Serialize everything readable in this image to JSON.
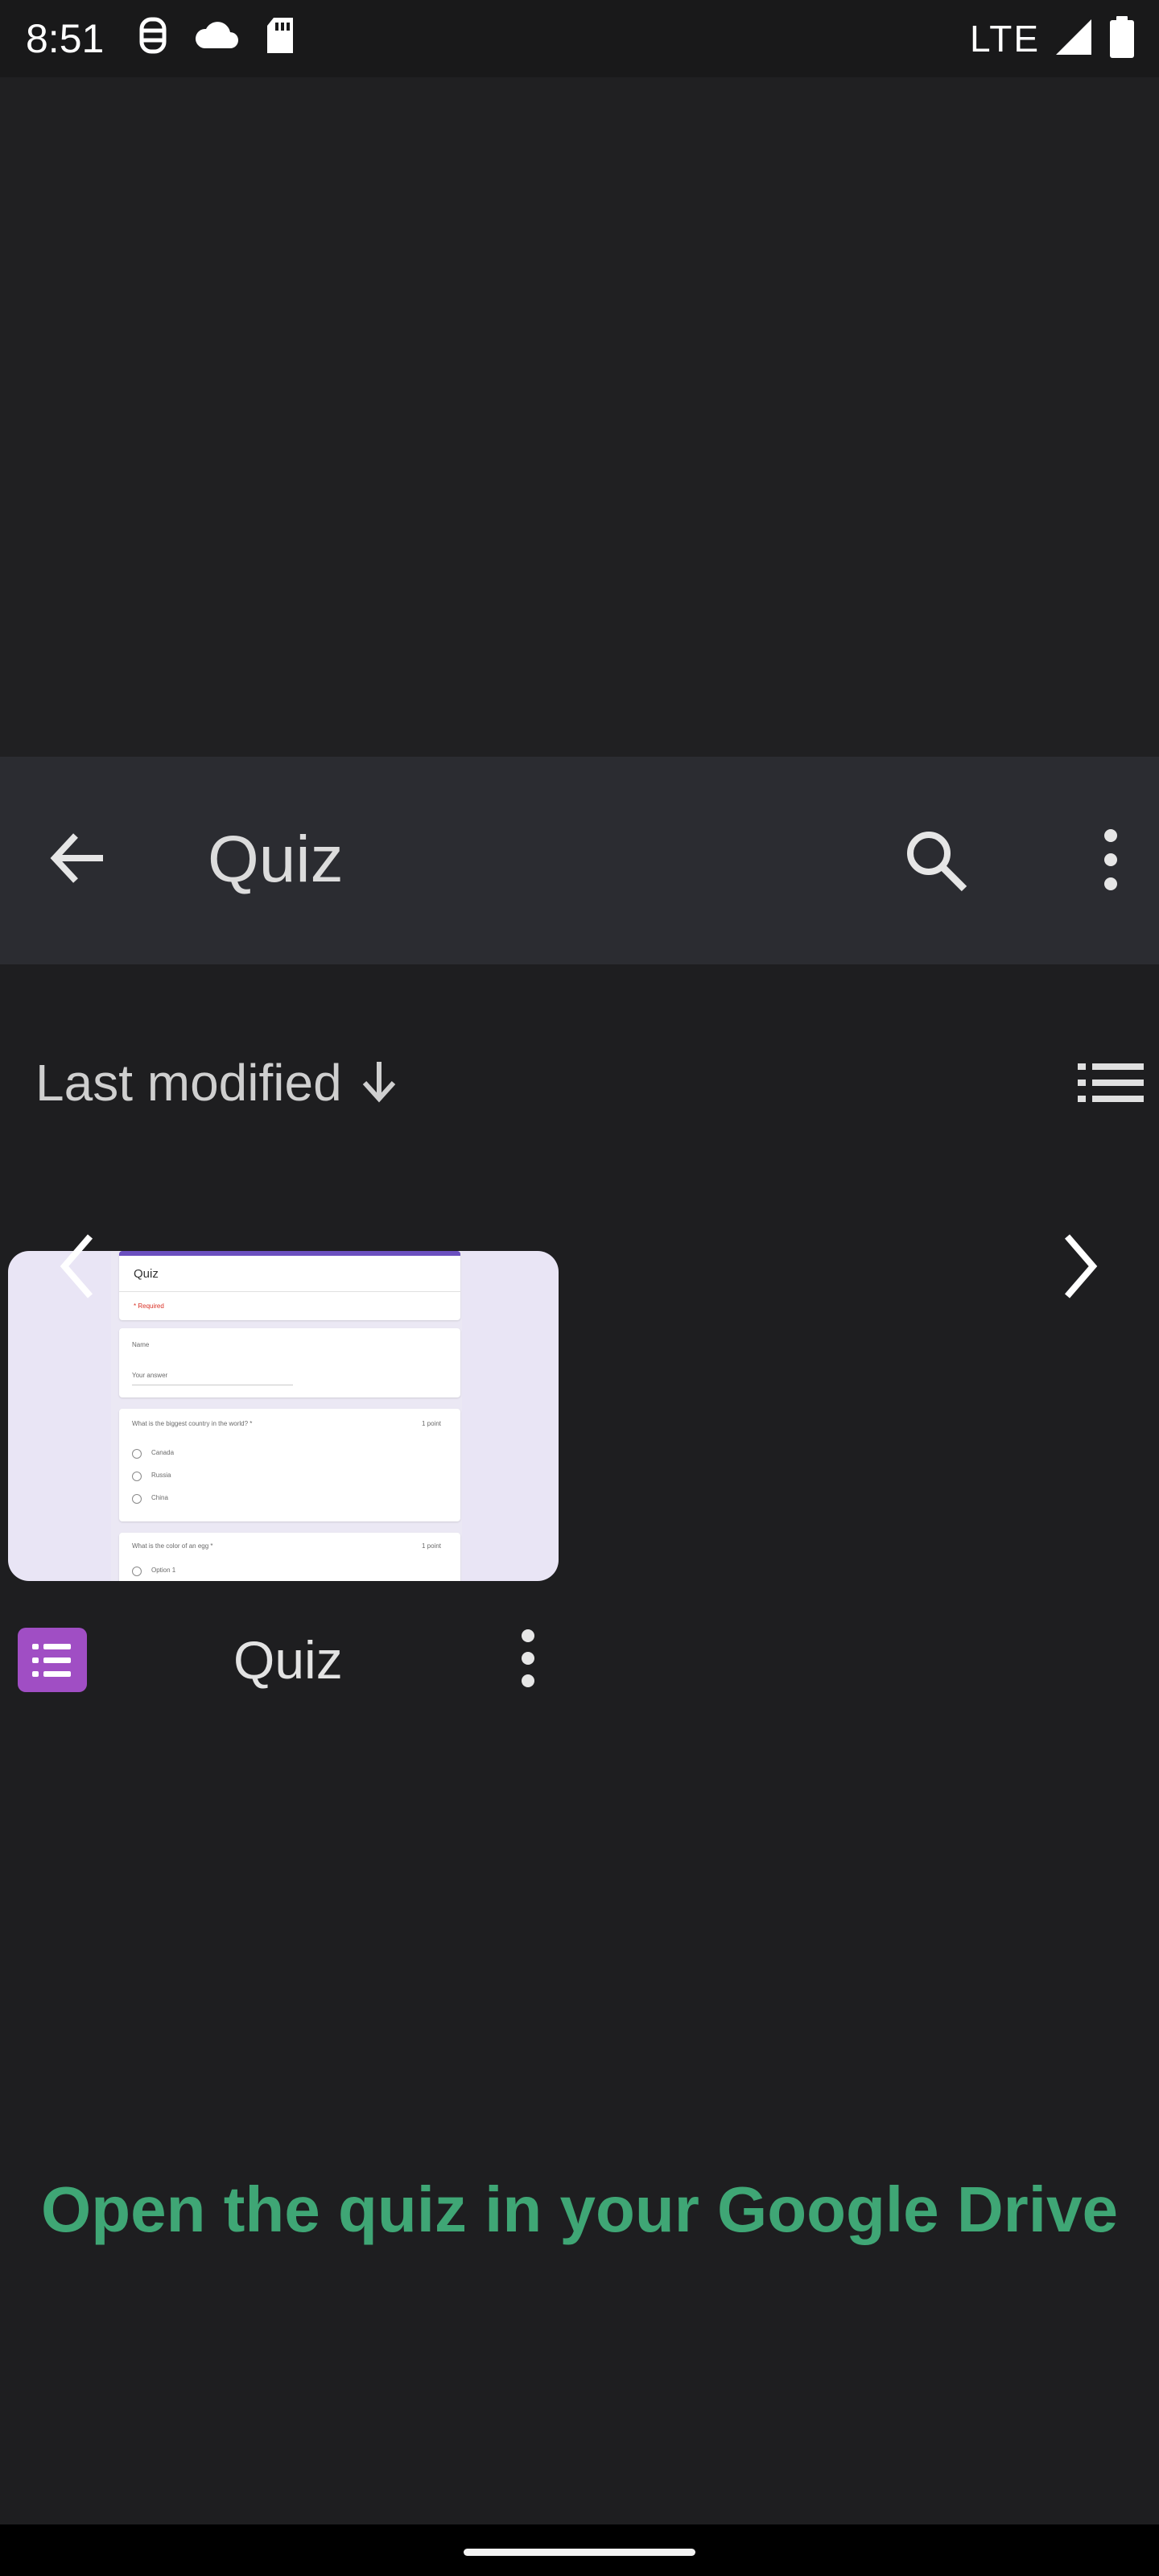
{
  "status_bar": {
    "time": "8:51",
    "network": "LTE",
    "left_icons": [
      "debug-icon",
      "cloud-icon",
      "sd-card-icon"
    ],
    "right_icons": [
      "signal-icon",
      "battery-icon"
    ]
  },
  "app_bar": {
    "title": "Quiz",
    "back_icon": "arrow-back-icon",
    "search_icon": "search-icon",
    "more_icon": "more-vert-icon"
  },
  "sort": {
    "label": "Last modified",
    "direction_icon": "arrow-down-icon",
    "view_icon": "list-view-icon"
  },
  "file": {
    "name": "Quiz",
    "type_icon": "google-forms-icon",
    "more_icon": "more-vert-icon",
    "preview": {
      "title": "Quiz",
      "required_note": "* Required",
      "name_label": "Name",
      "name_placeholder": "Your answer",
      "q1": "What is the biggest country in the world? *",
      "q1_points": "1 point",
      "q1_options": [
        "Canada",
        "Russia",
        "China"
      ],
      "q2": "What is the color of an egg *",
      "q2_points": "1 point",
      "q2_option": "Option 1"
    }
  },
  "carousel": {
    "prev_icon": "chevron-left-icon",
    "next_icon": "chevron-right-icon"
  },
  "caption": "Open the quiz in your Google Drive",
  "colors": {
    "background": "#1e1e20",
    "app_bar": "#2b2c31",
    "caption": "#3fa675",
    "forms_purple": "#a04ec4"
  }
}
